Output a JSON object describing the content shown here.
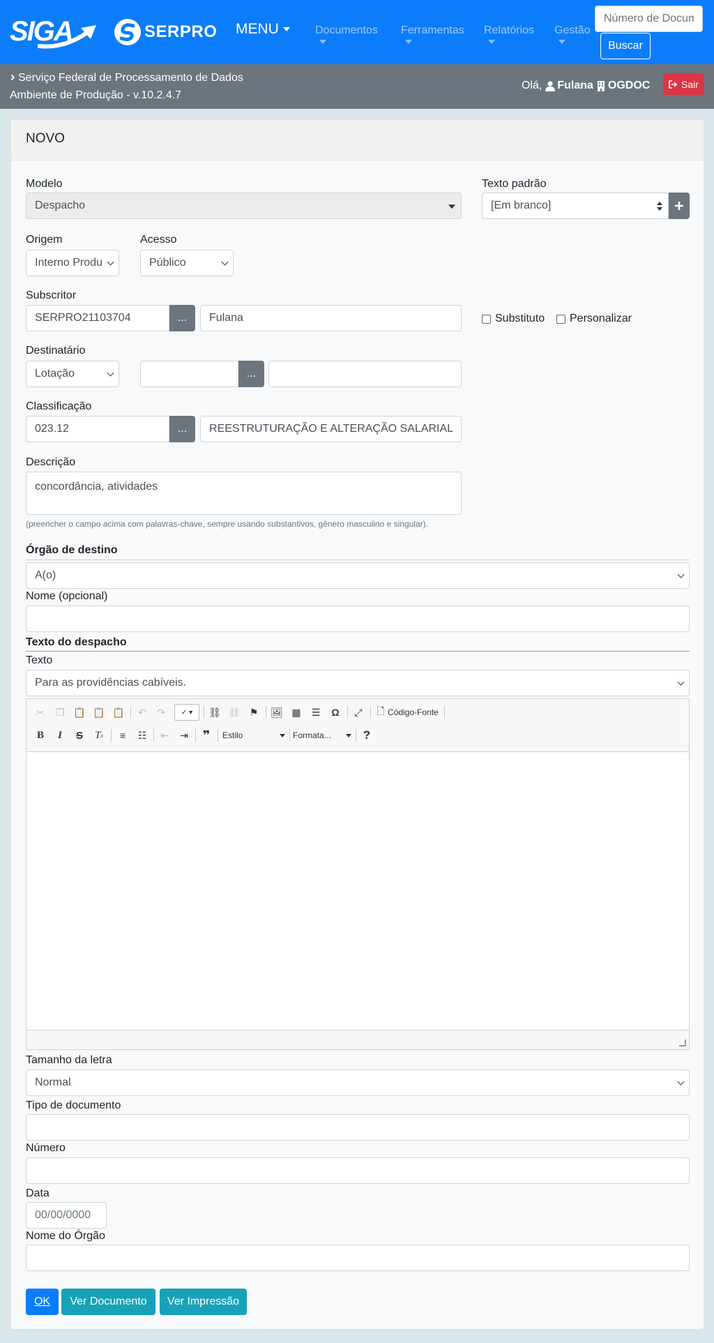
{
  "navbar": {
    "siga_logo_text": "SIGA",
    "serpro_logo_text": "SERPRO",
    "menu_label": "MENU",
    "items": [
      "Documentos",
      "Ferramentas",
      "Relatórios",
      "Gestão"
    ],
    "search_placeholder": "Número de Documento",
    "search_button": "Buscar"
  },
  "subbar": {
    "org_name": "Serviço Federal de Processamento de Dados",
    "environment": "Ambiente de Produção - v.10.2.4.7",
    "greeting": "Olá,",
    "user_name": "Fulana",
    "unit": "OGDOC",
    "logout": "Sair"
  },
  "card": {
    "title": "NOVO"
  },
  "form": {
    "modelo_label": "Modelo",
    "modelo_value": "Despacho",
    "texto_padrao_label": "Texto padrão",
    "texto_padrao_value": "[Em branco]",
    "origem_label": "Origem",
    "origem_value": "Interno Produzido",
    "acesso_label": "Acesso",
    "acesso_value": "Público",
    "subscritor_label": "Subscritor",
    "subscritor_code": "SERPRO21103704",
    "subscritor_name": "Fulana",
    "lookup_button": "...",
    "substituto_label": "Substituto",
    "personalizar_label": "Personalizar",
    "destinatario_label": "Destinatário",
    "destinatario_type": "Lotação",
    "destinatario_code": "",
    "destinatario_name": "",
    "classificacao_label": "Classificação",
    "classificacao_code": "023.12",
    "classificacao_name": "REESTRUTURAÇÃO E ALTERAÇÃO SALARIAL",
    "descricao_label": "Descrição",
    "descricao_value": "concordância, atividades",
    "descricao_hint": "(preencher o campo acima com palavras-chave, sempre usando substantivos, gênero masculino e singular).",
    "orgao_destino_heading": "Órgão de destino",
    "orgao_destino_value": "A(o)",
    "nome_opcional_label": "Nome (opcional)",
    "nome_opcional_value": "",
    "texto_despacho_heading": "Texto do despacho",
    "texto_label": "Texto",
    "texto_value": "Para as providências cabíveis.",
    "tamanho_letra_label": "Tamanho da letra",
    "tamanho_letra_value": "Normal",
    "tipo_documento_label": "Tipo de documento",
    "tipo_documento_value": "",
    "numero_label": "Número",
    "numero_value": "",
    "data_label": "Data",
    "data_placeholder": "00/00/0000",
    "nome_orgao_label": "Nome do Órgão",
    "nome_orgao_value": ""
  },
  "editor": {
    "source_label": "Código-Fonte",
    "style_combo": "Estilo",
    "format_combo": "Formata...",
    "help": "?"
  },
  "actions": {
    "ok": "OK",
    "ver_documento": "Ver Documento",
    "ver_impressao": "Ver Impressão"
  },
  "colors": {
    "primary": "#0b7dfb",
    "secondary": "#6c757d",
    "danger": "#dc3545",
    "info": "#17a2b8"
  }
}
